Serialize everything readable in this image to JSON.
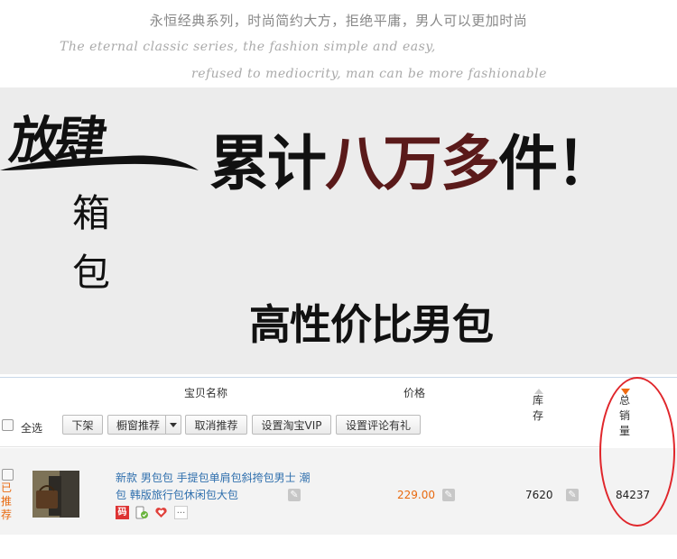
{
  "header": {
    "tagline_cn": "永恒经典系列，时尚简约大方，拒绝平庸，男人可以更加时尚",
    "tagline_en_1": "The eternal classic series, the fashion simple and easy,",
    "tagline_en_2": "refused to mediocrity, man can be more fashionable"
  },
  "banner": {
    "logo_main": "放肆",
    "logo_vertical_1": "箱",
    "logo_vertical_2": "包",
    "headline_dark_1": "累计",
    "headline_red": "八万多",
    "headline_dark_2": "件！",
    "subline": "高性价比男包"
  },
  "table_header": {
    "name": "宝贝名称",
    "price": "价格",
    "stock": "库存",
    "sales": "总销量"
  },
  "toolbar": {
    "select_all": "全选",
    "btn_off_shelf": "下架",
    "btn_window_recommend": "橱窗推荐",
    "btn_cancel_recommend": "取消推荐",
    "btn_set_vip": "设置淘宝VIP",
    "btn_set_review_gift": "设置评论有礼"
  },
  "product": {
    "recommended_label": "已推荐",
    "title": "新款 男包包 手提包单肩包斜挎包男士 潮包 韩版旅行包休闲包大包",
    "badge_code": "码",
    "badge_more": "...",
    "price": "229.00",
    "stock": "7620",
    "sales": "84237"
  },
  "colors": {
    "link_blue": "#2f6fad",
    "price_orange": "#e86a10",
    "headline_red": "#5a1a1a",
    "circle_red": "#e0262b"
  }
}
